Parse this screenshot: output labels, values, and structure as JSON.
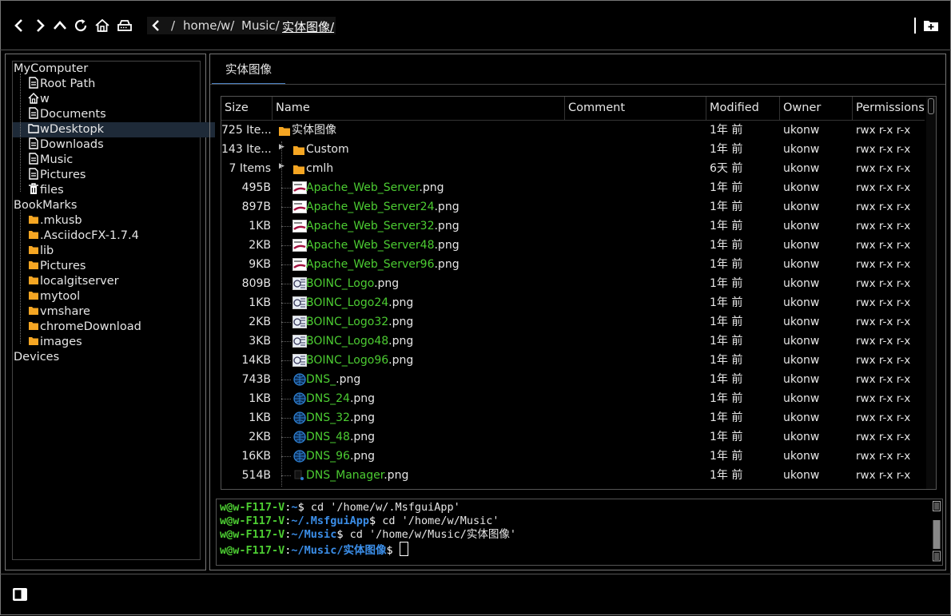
{
  "toolbar": {
    "icons": [
      "back-icon",
      "forward-icon",
      "up-icon",
      "refresh-icon",
      "home-icon",
      "drive-icon"
    ],
    "path": [
      "/",
      "home/",
      "w/",
      "Music/",
      "实体图像/"
    ]
  },
  "sidebar": {
    "mycomputer": "MyComputer",
    "computer_items": [
      {
        "label": "Root Path",
        "icon": "file-icon"
      },
      {
        "label": "w",
        "icon": "home-icon"
      },
      {
        "label": "Documents",
        "icon": "file-icon"
      },
      {
        "label": "wDesktopk",
        "icon": "folder-outline-icon"
      },
      {
        "label": "Downloads",
        "icon": "file-icon"
      },
      {
        "label": "Music",
        "icon": "file-icon"
      },
      {
        "label": "Pictures",
        "icon": "file-icon"
      },
      {
        "label": "files",
        "icon": "trash-icon"
      }
    ],
    "bookmarks": "BookMarks",
    "bookmark_items": [
      ".mkusb",
      ".AsciidocFX-1.7.4",
      "lib",
      "Pictures",
      "localgitserver",
      "mytool",
      "vmshare",
      "chromeDownload",
      "images"
    ],
    "devices": "Devices"
  },
  "tab": {
    "label": "实体图像"
  },
  "table": {
    "headers": [
      "Size",
      "Name",
      "Comment",
      "Modified",
      "Owner",
      "Permissions"
    ],
    "rows": [
      {
        "size": "725 Ite...",
        "name": "实体图像",
        "ext": "",
        "type": "folder",
        "modified": "1年 前",
        "owner": "ukonw",
        "perm": "rwx r-x r-x",
        "level": 0
      },
      {
        "size": "143 Ite...",
        "name": "Custom",
        "ext": "",
        "type": "folder",
        "modified": "1年 前",
        "owner": "ukonw",
        "perm": "rwx r-x r-x",
        "level": 1
      },
      {
        "size": "7 Items",
        "name": "cmlh",
        "ext": "",
        "type": "folder",
        "modified": "6天 前",
        "owner": "ukonw",
        "perm": "rwx r-x r-x",
        "level": 1
      },
      {
        "size": "495B",
        "name": "Apache_Web_Server",
        "ext": ".png",
        "type": "apache",
        "modified": "1年 前",
        "owner": "ukonw",
        "perm": "rwx r-x r-x",
        "level": 1
      },
      {
        "size": "897B",
        "name": "Apache_Web_Server24",
        "ext": ".png",
        "type": "apache",
        "modified": "1年 前",
        "owner": "ukonw",
        "perm": "rwx r-x r-x",
        "level": 1
      },
      {
        "size": "1KB",
        "name": "Apache_Web_Server32",
        "ext": ".png",
        "type": "apache",
        "modified": "1年 前",
        "owner": "ukonw",
        "perm": "rwx r-x r-x",
        "level": 1
      },
      {
        "size": "2KB",
        "name": "Apache_Web_Server48",
        "ext": ".png",
        "type": "apache",
        "modified": "1年 前",
        "owner": "ukonw",
        "perm": "rwx r-x r-x",
        "level": 1
      },
      {
        "size": "9KB",
        "name": "Apache_Web_Server96",
        "ext": ".png",
        "type": "apache",
        "modified": "1年 前",
        "owner": "ukonw",
        "perm": "rwx r-x r-x",
        "level": 1
      },
      {
        "size": "809B",
        "name": "BOINC_Logo",
        "ext": ".png",
        "type": "boinc",
        "modified": "1年 前",
        "owner": "ukonw",
        "perm": "rwx r-x r-x",
        "level": 1
      },
      {
        "size": "1KB",
        "name": "BOINC_Logo24",
        "ext": ".png",
        "type": "boinc",
        "modified": "1年 前",
        "owner": "ukonw",
        "perm": "rwx r-x r-x",
        "level": 1
      },
      {
        "size": "2KB",
        "name": "BOINC_Logo32",
        "ext": ".png",
        "type": "boinc",
        "modified": "1年 前",
        "owner": "ukonw",
        "perm": "rwx r-x r-x",
        "level": 1
      },
      {
        "size": "3KB",
        "name": "BOINC_Logo48",
        "ext": ".png",
        "type": "boinc",
        "modified": "1年 前",
        "owner": "ukonw",
        "perm": "rwx r-x r-x",
        "level": 1
      },
      {
        "size": "14KB",
        "name": "BOINC_Logo96",
        "ext": ".png",
        "type": "boinc",
        "modified": "1年 前",
        "owner": "ukonw",
        "perm": "rwx r-x r-x",
        "level": 1
      },
      {
        "size": "743B",
        "name": "DNS_",
        "ext": ".png",
        "type": "dns",
        "modified": "1年 前",
        "owner": "ukonw",
        "perm": "rwx r-x r-x",
        "level": 1
      },
      {
        "size": "1KB",
        "name": "DNS_24",
        "ext": ".png",
        "type": "dns",
        "modified": "1年 前",
        "owner": "ukonw",
        "perm": "rwx r-x r-x",
        "level": 1
      },
      {
        "size": "1KB",
        "name": "DNS_32",
        "ext": ".png",
        "type": "dns",
        "modified": "1年 前",
        "owner": "ukonw",
        "perm": "rwx r-x r-x",
        "level": 1
      },
      {
        "size": "2KB",
        "name": "DNS_48",
        "ext": ".png",
        "type": "dns",
        "modified": "1年 前",
        "owner": "ukonw",
        "perm": "rwx r-x r-x",
        "level": 1
      },
      {
        "size": "16KB",
        "name": "DNS_96",
        "ext": ".png",
        "type": "dns",
        "modified": "1年 前",
        "owner": "ukonw",
        "perm": "rwx r-x r-x",
        "level": 1
      },
      {
        "size": "514B",
        "name": "DNS_Manager",
        "ext": ".png",
        "type": "dnsmgr",
        "modified": "1年 前",
        "owner": "ukonw",
        "perm": "rwx r-x r-x",
        "level": 1
      }
    ]
  },
  "terminal": {
    "lines": [
      {
        "user": "w@w-F117-V",
        "path": "~",
        "cmd": " cd '/home/w/.MsfguiApp'"
      },
      {
        "user": "w@w-F117-V",
        "path": "~/.MsfguiApp",
        "cmd": " cd '/home/w/Music'"
      },
      {
        "user": "w@w-F117-V",
        "path": "~/Music",
        "cmd": " cd '/home/w/Music/实体图像'"
      },
      {
        "user": "w@w-F117-V",
        "path": "~/Music/实体图像",
        "cmd": " "
      }
    ]
  },
  "colors": {
    "green": "#4ccc32",
    "blue": "#3b8ee8",
    "folder": "#f5a623",
    "accent": "#4a7fc0"
  }
}
